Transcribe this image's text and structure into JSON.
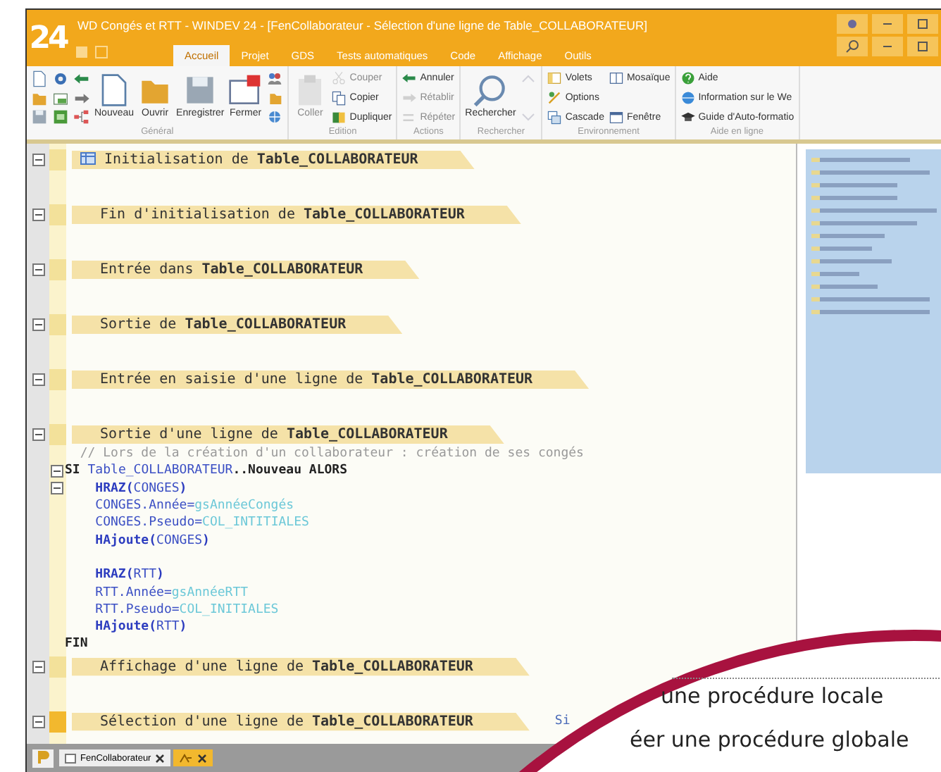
{
  "window": {
    "title": "WD Congés et RTT - WINDEV 24 - [FenCollaborateur - Sélection d'une ligne de Table_COLLABORATEUR]",
    "logo": "24"
  },
  "ribbon_tabs": [
    {
      "label": "Accueil",
      "selected": true
    },
    {
      "label": "Projet",
      "selected": false
    },
    {
      "label": "GDS",
      "selected": false
    },
    {
      "label": "Tests automatiques",
      "selected": false
    },
    {
      "label": "Code",
      "selected": false
    },
    {
      "label": "Affichage",
      "selected": false
    },
    {
      "label": "Outils",
      "selected": false
    }
  ],
  "ribbon_groups": [
    {
      "label": "Général",
      "columns": [
        [
          {
            "kind": "icon"
          },
          {
            "kind": "icon"
          },
          {
            "kind": "icon"
          }
        ],
        [
          {
            "kind": "icon"
          },
          {
            "kind": "icon"
          },
          {
            "kind": "icon"
          }
        ],
        [
          {
            "kind": "icon"
          },
          {
            "kind": "icon"
          },
          {
            "kind": "icon"
          }
        ],
        [
          {
            "kind": "large",
            "label": "Nouveau",
            "disabled": false
          }
        ],
        [
          {
            "kind": "large",
            "label": "Ouvrir",
            "disabled": false
          }
        ],
        [
          {
            "kind": "large",
            "label": "Enregistrer",
            "disabled": false
          }
        ],
        [
          {
            "kind": "large",
            "label": "Fermer",
            "disabled": false
          }
        ],
        [
          {
            "kind": "icon"
          },
          {
            "kind": "icon"
          },
          {
            "kind": "icon"
          }
        ]
      ]
    },
    {
      "label": "Edition",
      "columns": [
        [
          {
            "kind": "large",
            "label": "Coller",
            "disabled": true
          }
        ],
        [
          {
            "kind": "small",
            "label": "Couper",
            "disabled": true
          },
          {
            "kind": "small",
            "label": "Copier",
            "disabled": false
          },
          {
            "kind": "small",
            "label": "Dupliquer",
            "disabled": false
          }
        ]
      ]
    },
    {
      "label": "Actions",
      "columns": [
        [
          {
            "kind": "small",
            "label": "Annuler",
            "disabled": false
          },
          {
            "kind": "small",
            "label": "Rétablir",
            "disabled": true
          },
          {
            "kind": "small",
            "label": "Répéter",
            "disabled": true
          }
        ]
      ]
    },
    {
      "label": "Rechercher",
      "columns": [
        [
          {
            "kind": "large",
            "label": "Rechercher",
            "disabled": false
          }
        ],
        [
          {
            "kind": "icon",
            "disabled": true
          },
          {
            "kind": "icon",
            "disabled": true
          }
        ]
      ]
    },
    {
      "label": "Environnement",
      "columns": [
        [
          {
            "kind": "small",
            "label": "Volets",
            "disabled": false
          },
          {
            "kind": "small",
            "label": "Options",
            "disabled": false
          },
          {
            "kind": "small",
            "label": "Cascade",
            "disabled": false
          }
        ],
        [
          {
            "kind": "small",
            "label": "Mosaïque",
            "disabled": false
          },
          {
            "kind": "small",
            "label": "Fenêtre",
            "disabled": false
          }
        ]
      ]
    },
    {
      "label": "Aide en ligne",
      "columns": [
        [
          {
            "kind": "small",
            "label": "Aide",
            "disabled": false
          },
          {
            "kind": "small",
            "label": "Information sur le We",
            "disabled": false
          },
          {
            "kind": "small",
            "label": "Guide d'Auto-formatio",
            "disabled": false
          }
        ]
      ]
    }
  ],
  "events": [
    {
      "header": "Initialisation de **Table_COLLABORATEUR**",
      "selected": false
    },
    {
      "header": "Fin d'initialisation de **Table_COLLABORATEUR**",
      "selected": false
    },
    {
      "header": "Entrée dans **Table_COLLABORATEUR**",
      "selected": false
    },
    {
      "header": "Sortie de **Table_COLLABORATEUR**",
      "selected": false
    },
    {
      "header": "Entrée en saisie d'une ligne de **Table_COLLABORATEUR**",
      "selected": false
    },
    {
      "header": "Sortie d'une ligne de **Table_COLLABORATEUR**",
      "selected": false,
      "lines": [
        {
          "fold": false,
          "tokens": [
            {
              "kind": "comment",
              "text": "  // Lors de la création d'un collaborateur : création de ses congés"
            }
          ]
        },
        {
          "fold": true,
          "tokens": [
            {
              "kind": "keyword",
              "text": "SI "
            },
            {
              "kind": "ident",
              "text": "Table_COLLABORATEUR"
            },
            {
              "kind": "keyword",
              "text": "..Nouveau ALORS"
            }
          ]
        },
        {
          "fold": true,
          "tokens": [
            {
              "kind": "func",
              "text": "    HRAZ"
            },
            {
              "kind": "plain",
              "text": "("
            },
            {
              "kind": "ident",
              "text": "CONGES"
            },
            {
              "kind": "plain",
              "text": ")"
            }
          ]
        },
        {
          "fold": false,
          "tokens": [
            {
              "kind": "ident",
              "text": "    CONGES.Année="
            },
            {
              "kind": "var",
              "text": "gsAnnéeCongés"
            }
          ]
        },
        {
          "fold": false,
          "tokens": [
            {
              "kind": "ident",
              "text": "    CONGES.Pseudo="
            },
            {
              "kind": "var",
              "text": "COL_INTITIALES"
            }
          ]
        },
        {
          "fold": false,
          "tokens": [
            {
              "kind": "func",
              "text": "    HAjoute"
            },
            {
              "kind": "plain",
              "text": "("
            },
            {
              "kind": "ident",
              "text": "CONGES"
            },
            {
              "kind": "plain",
              "text": ")"
            }
          ]
        },
        {
          "fold": false
        },
        {
          "fold": false,
          "tokens": [
            {
              "kind": "func",
              "text": "    HRAZ"
            },
            {
              "kind": "plain",
              "text": "("
            },
            {
              "kind": "ident",
              "text": "RTT"
            },
            {
              "kind": "plain",
              "text": ")"
            }
          ]
        },
        {
          "fold": false,
          "tokens": [
            {
              "kind": "ident",
              "text": "    RTT.Année="
            },
            {
              "kind": "var",
              "text": "gsAnnéeRTT"
            }
          ]
        },
        {
          "fold": false,
          "tokens": [
            {
              "kind": "ident",
              "text": "    RTT.Pseudo="
            },
            {
              "kind": "var",
              "text": "COL_INITIALES"
            }
          ]
        },
        {
          "fold": false,
          "tokens": [
            {
              "kind": "func",
              "text": "    HAjoute"
            },
            {
              "kind": "plain",
              "text": "("
            },
            {
              "kind": "ident",
              "text": "RTT"
            },
            {
              "kind": "plain",
              "text": ")"
            }
          ]
        },
        {
          "fold": false,
          "tokens": [
            {
              "kind": "keyword",
              "text": "FIN"
            }
          ]
        }
      ]
    },
    {
      "header": "Affichage d'une ligne de **Table_COLLABORATEUR**",
      "selected": false
    },
    {
      "header": "Sélection d'une ligne de **Table_COLLABORATEUR**",
      "selected": true,
      "hint": "Si"
    }
  ],
  "document_tabs": [
    {
      "label": "FenCollaborateur",
      "selected": false
    },
    {
      "kind": "icon",
      "selected": true
    }
  ],
  "callout": {
    "items": [
      "une procédure locale",
      "éer une procédure globale"
    ]
  }
}
